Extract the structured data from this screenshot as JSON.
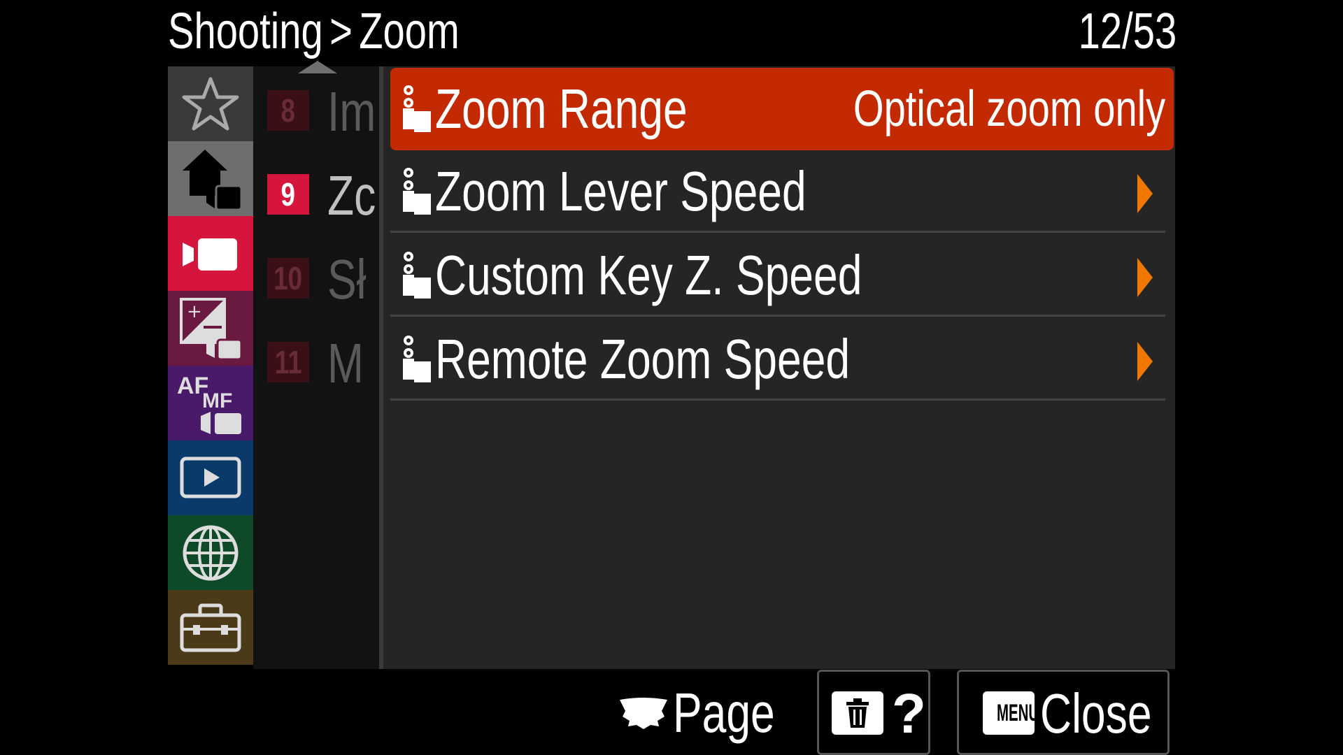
{
  "header": {
    "section": "Shooting",
    "separator": ">",
    "page_title": "Zoom",
    "page_counter": "12/53"
  },
  "categories": [
    {
      "name": "favorites",
      "icon": "star-icon",
      "color": "#3a3a3a"
    },
    {
      "name": "main",
      "icon": "house-movie-icon",
      "color": "#6e6e6e"
    },
    {
      "name": "shooting",
      "icon": "movie-camera-icon",
      "color": "#d6153c"
    },
    {
      "name": "exposure-color",
      "icon": "exposure-movie-icon",
      "color": "#6a1a40"
    },
    {
      "name": "focus",
      "icon": "af-mf-movie-icon",
      "color": "#4a1a6a"
    },
    {
      "name": "playback",
      "icon": "playback-icon",
      "color": "#0a3a6a"
    },
    {
      "name": "network",
      "icon": "globe-icon",
      "color": "#0f4a28"
    },
    {
      "name": "setup",
      "icon": "toolbox-icon",
      "color": "#4a3a18"
    }
  ],
  "sub_pages": [
    {
      "number": "8",
      "label": "Im",
      "active": false
    },
    {
      "number": "9",
      "label": "Zc",
      "active": true
    },
    {
      "number": "10",
      "label": "Sł",
      "active": false
    },
    {
      "number": "11",
      "label": "M",
      "active": false
    }
  ],
  "menu_items": [
    {
      "label": "Zoom Range",
      "value": "Optical zoom only",
      "selected": true,
      "has_submenu": false
    },
    {
      "label": "Zoom Lever Speed",
      "value": "",
      "selected": false,
      "has_submenu": true
    },
    {
      "label": "Custom Key Z. Speed",
      "value": "",
      "selected": false,
      "has_submenu": true
    },
    {
      "label": "Remote Zoom Speed",
      "value": "",
      "selected": false,
      "has_submenu": true
    }
  ],
  "footer": {
    "page_label": "Page",
    "help_label": "?",
    "menu_key_label": "MENU",
    "close_label": "Close"
  },
  "colors": {
    "selected_row": "#c42a02",
    "arrow": "#f07800",
    "active_page_badge": "#d6153c"
  }
}
